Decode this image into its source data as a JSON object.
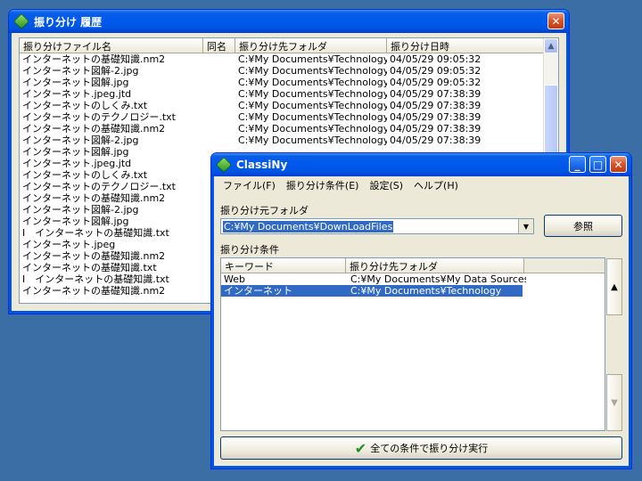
{
  "history": {
    "title": "振り分け 履歴",
    "columns": [
      "振り分けファイル名",
      "同名",
      "振り分け先フォルダ",
      "振り分け日時"
    ],
    "rows": [
      [
        "インターネットの基礎知識.nm2",
        "",
        "C:¥My Documents¥Technology",
        "04/05/29 09:05:32"
      ],
      [
        "インターネット図解-2.jpg",
        "",
        "C:¥My Documents¥Technology",
        "04/05/29 09:05:32"
      ],
      [
        "インターネット図解.jpg",
        "",
        "C:¥My Documents¥Technology",
        "04/05/29 09:05:32"
      ],
      [
        "インターネット.jpeg.jtd",
        "",
        "C:¥My Documents¥Technology",
        "04/05/29 07:38:39"
      ],
      [
        "インターネットのしくみ.txt",
        "",
        "C:¥My Documents¥Technology",
        "04/05/29 07:38:39"
      ],
      [
        "インターネットのテクノロジー.txt",
        "",
        "C:¥My Documents¥Technology",
        "04/05/29 07:38:39"
      ],
      [
        "インターネットの基礎知識.nm2",
        "",
        "C:¥My Documents¥Technology",
        "04/05/29 07:38:39"
      ],
      [
        "インターネット図解-2.jpg",
        "",
        "C:¥My Documents¥Technology",
        "04/05/29 07:38:39"
      ],
      [
        "インターネット図解.jpg",
        "",
        "",
        ""
      ],
      [
        "インターネット.jpeg.jtd",
        "",
        "",
        ""
      ],
      [
        "インターネットのしくみ.txt",
        "",
        "",
        ""
      ],
      [
        "インターネットのテクノロジー.txt",
        "",
        "",
        ""
      ],
      [
        "インターネットの基礎知識.nm2",
        "",
        "",
        ""
      ],
      [
        "インターネット図解-2.jpg",
        "",
        "",
        ""
      ],
      [
        "インターネット図解.jpg",
        "",
        "",
        ""
      ],
      [
        "I　インターネットの基礎知識.txt",
        "",
        "",
        ""
      ],
      [
        "インターネット.jpeg",
        "",
        "",
        ""
      ],
      [
        "インターネットの基礎知識.nm2",
        "",
        "",
        ""
      ],
      [
        "インターネットの基礎知識.txt",
        "",
        "",
        ""
      ],
      [
        "I　インターネットの基礎知識.txt",
        "",
        "",
        ""
      ],
      [
        "インターネットの基礎知識.nm2",
        "",
        "",
        ""
      ]
    ]
  },
  "classiny": {
    "title": "ClassiNy",
    "menu": [
      "ファイル(F)",
      "振り分け条件(E)",
      "設定(S)",
      "ヘルプ(H)"
    ],
    "source_folder_label": "振り分け元フォルダ",
    "source_folder_value": "C:¥My Documents¥DownLoadFiles",
    "browse_label": "参照",
    "conditions_label": "振り分け条件",
    "cond_columns": [
      "キーワード",
      "振り分け先フォルダ"
    ],
    "cond_rows": [
      [
        "Web",
        "C:¥My Documents¥My Data Sources"
      ],
      [
        "インターネット",
        "C:¥My Documents¥Technology"
      ]
    ],
    "run_label": "全ての条件で振り分け実行"
  }
}
